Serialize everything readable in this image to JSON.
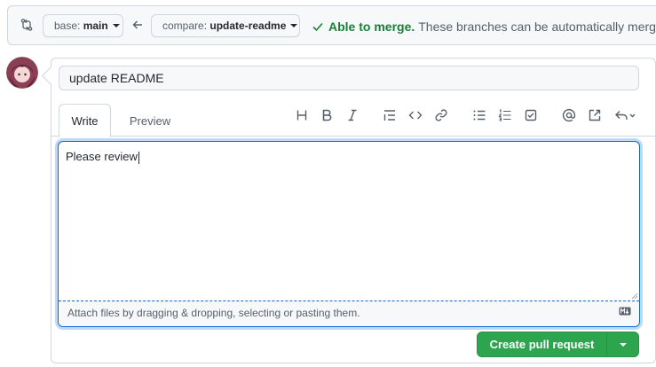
{
  "compare": {
    "base_prefix": "base:",
    "base_branch": "main",
    "compare_prefix": "compare:",
    "compare_branch": "update-readme",
    "merge_status": "Able to merge.",
    "merge_message": "These branches can be automatically merged."
  },
  "pull_request": {
    "title": "update README",
    "tabs": {
      "write": "Write",
      "preview": "Preview"
    },
    "body": "Please review",
    "attach_hint": "Attach files by dragging & dropping, selecting or pasting them.",
    "submit_label": "Create pull request"
  },
  "toolbar": [
    "heading",
    "bold",
    "italic",
    "quote",
    "code",
    "link",
    "unordered-list",
    "ordered-list",
    "task-list",
    "mention",
    "reference",
    "reply"
  ],
  "colors": {
    "accent_blue": "#0969da",
    "merge_green": "#1a7f37",
    "button_green": "#2da44e",
    "border": "#d0d7de",
    "muted_text": "#57606a"
  }
}
